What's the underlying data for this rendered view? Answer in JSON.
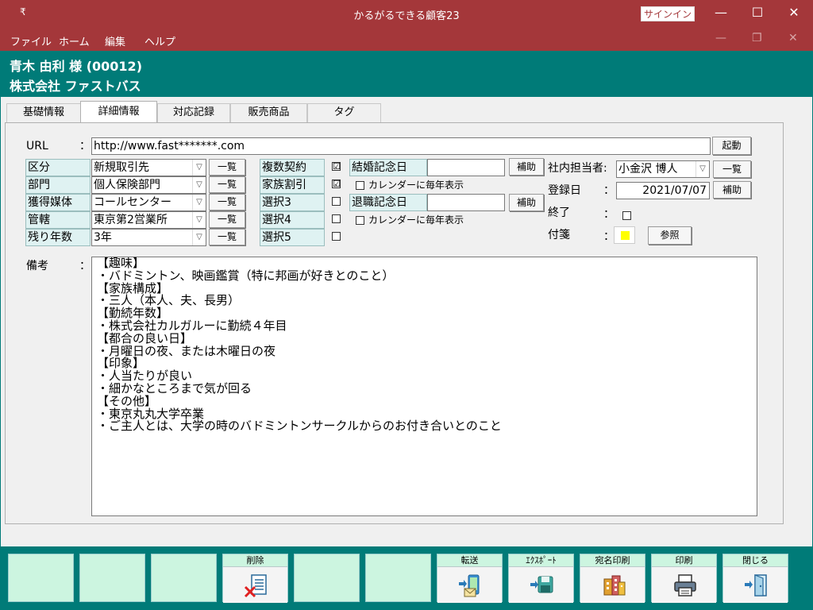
{
  "window": {
    "title": "かるがるできる顧客23",
    "quick_access": "₹",
    "signin": "サインイン",
    "minimize": "—",
    "maximize": "☐",
    "close": "✕"
  },
  "menu": {
    "items": [
      "ファイル",
      "ホーム",
      "編集",
      "ヘルプ"
    ],
    "mdi_minimize": "—",
    "mdi_restore": "❐",
    "mdi_close": "✕"
  },
  "customer": {
    "line1": "青木 由利 様 (00012)",
    "line2": "株式会社 ファストバス"
  },
  "tabs": [
    "基礎情報",
    "詳細情報",
    "対応記録",
    "販売商品",
    "タグ"
  ],
  "form": {
    "url_label": "URL",
    "colon": "：",
    "url_value": "http://www.fast*******.com",
    "launch_button": "起動",
    "list_button": "一覧",
    "assist_button": "補助",
    "fields": [
      {
        "label": "区分",
        "value": "新規取引先"
      },
      {
        "label": "部門",
        "value": "個人保険部門"
      },
      {
        "label": "獲得媒体",
        "value": "コールセンター"
      },
      {
        "label": "管轄",
        "value": "東京第2営業所"
      },
      {
        "label": "残り年数",
        "value": "3年"
      }
    ],
    "options": [
      {
        "label": "複数契約",
        "checked": "☑"
      },
      {
        "label": "家族割引",
        "checked": "☑"
      },
      {
        "label": "選択3",
        "checked": ""
      },
      {
        "label": "選択4",
        "checked": ""
      },
      {
        "label": "選択5",
        "checked": ""
      }
    ],
    "anniv1_label": "結婚記念日",
    "anniv1_value": "",
    "anniv2_label": "退職記念日",
    "anniv2_value": "",
    "calendar_yearly": "カレンダーに毎年表示",
    "staff_label": "社内担当者:",
    "staff_value": "小金沢 博人",
    "reg_label": "登録日",
    "reg_value": "2021/07/07",
    "end_label": "終了",
    "sticky_label": "付箋",
    "sticky_color": "#ffff00",
    "ref_button": "参照",
    "memo_label": "備考",
    "memo_lines": [
      "【趣味】",
      "・バドミントン、映画鑑賞（特に邦画が好きとのこと）",
      "",
      "【家族構成】",
      "・三人（本人、夫、長男）",
      "",
      "【勤続年数】",
      "・株式会社カルガルーに勤続４年目",
      "",
      "【都合の良い日】",
      "・月曜日の夜、または木曜日の夜",
      "",
      "【印象】",
      "・人当たりが良い",
      "・細かなところまで気が回る",
      "",
      "【その他】",
      "・東京丸丸大学卒業",
      "・ご主人とは、大学の時のバドミントンサークルからのお付き合いとのこと"
    ]
  },
  "footer": {
    "buttons": [
      {
        "label": "",
        "icon": ""
      },
      {
        "label": "",
        "icon": ""
      },
      {
        "label": "",
        "icon": ""
      },
      {
        "label": "削除",
        "icon": "delete-icon"
      },
      {
        "label": "",
        "icon": ""
      },
      {
        "label": "",
        "icon": ""
      },
      {
        "label": "転送",
        "icon": "transfer-icon"
      },
      {
        "label": "ｴｸｽﾎﾟｰﾄ",
        "icon": "export-icon"
      },
      {
        "label": "宛名印刷",
        "icon": "address-print-icon"
      },
      {
        "label": "印刷",
        "icon": "printer-icon"
      },
      {
        "label": "閉じる",
        "icon": "exit-door-icon"
      }
    ]
  }
}
